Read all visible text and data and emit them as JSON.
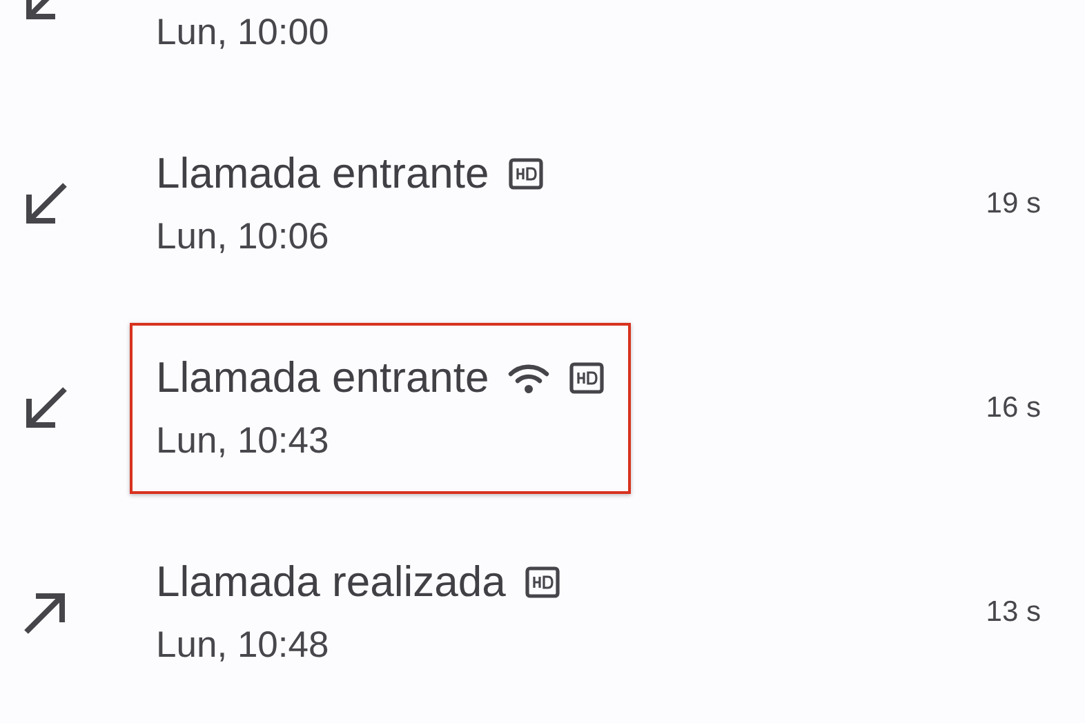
{
  "calls": [
    {
      "kind": "incoming",
      "date": "Lun, 10:00",
      "wifi": false,
      "hd": false,
      "highlighted": false
    },
    {
      "kind": "incoming",
      "title": "Llamada entrante",
      "date": "Lun, 10:06",
      "duration": "19 s",
      "wifi": false,
      "hd": true,
      "highlighted": false
    },
    {
      "kind": "incoming",
      "title": "Llamada entrante",
      "date": "Lun, 10:43",
      "duration": "16 s",
      "wifi": true,
      "hd": true,
      "highlighted": true
    },
    {
      "kind": "outgoing",
      "title": "Llamada realizada",
      "date": "Lun, 10:48",
      "duration": "13 s",
      "wifi": false,
      "hd": true,
      "highlighted": false
    }
  ]
}
